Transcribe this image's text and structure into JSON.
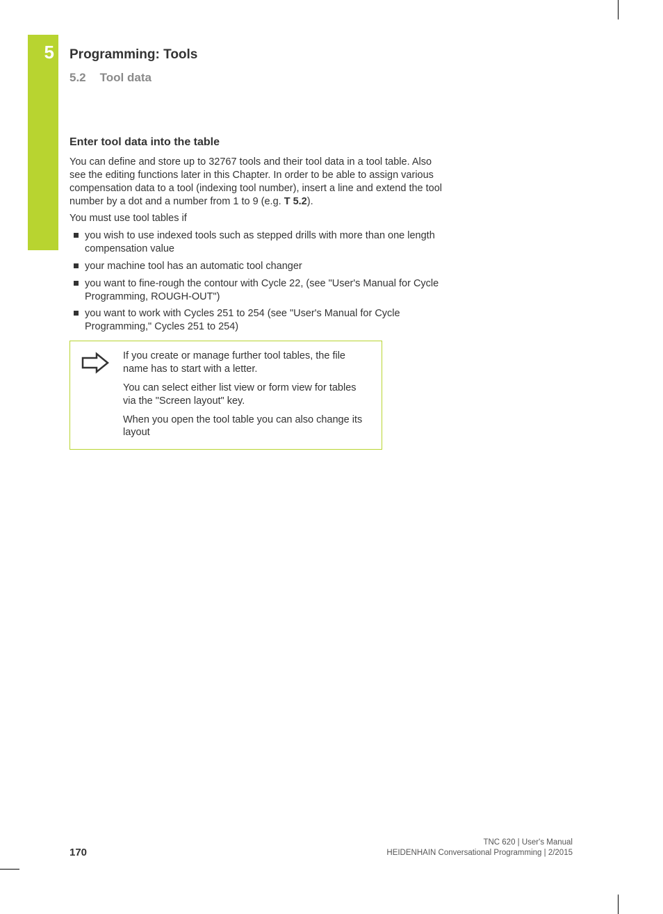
{
  "chapter_number": "5",
  "chapter_title": "Programming: Tools",
  "section_number": "5.2",
  "section_title": "Tool data",
  "subheading": "Enter tool data into the table",
  "intro_para_1": "You can define and store up to 32767 tools and their tool data in a tool table. Also see the editing functions later in this Chapter. In order to be able to assign various compensation data to a tool (indexing tool number), insert a line and extend the tool number by a dot and a number from 1 to 9 (e.g. ",
  "intro_code": "T 5.2",
  "intro_para_1_after": ").",
  "intro_para_2": "You must use tool tables if",
  "bullets": {
    "b0": "you wish to use indexed tools such as stepped drills with more than one length compensation value",
    "b1": "your machine tool has an automatic tool changer",
    "b2": "you want to fine-rough the contour with Cycle 22, (see \"User's Manual for Cycle Programming, ROUGH-OUT\")",
    "b3": "you want to work with Cycles 251 to 254 (see \"User's Manual for Cycle Programming,\" Cycles 251 to 254)"
  },
  "note": {
    "p0": "If you create or manage further tool tables, the file name has to start with a letter.",
    "p1": "You can select either list view or form view for tables via the \"Screen layout\" key.",
    "p2": "When you open the tool table you can also change its layout"
  },
  "footer": {
    "page": "170",
    "line1": "TNC 620 | User's Manual",
    "line2": "HEIDENHAIN Conversational Programming | 2/2015"
  }
}
